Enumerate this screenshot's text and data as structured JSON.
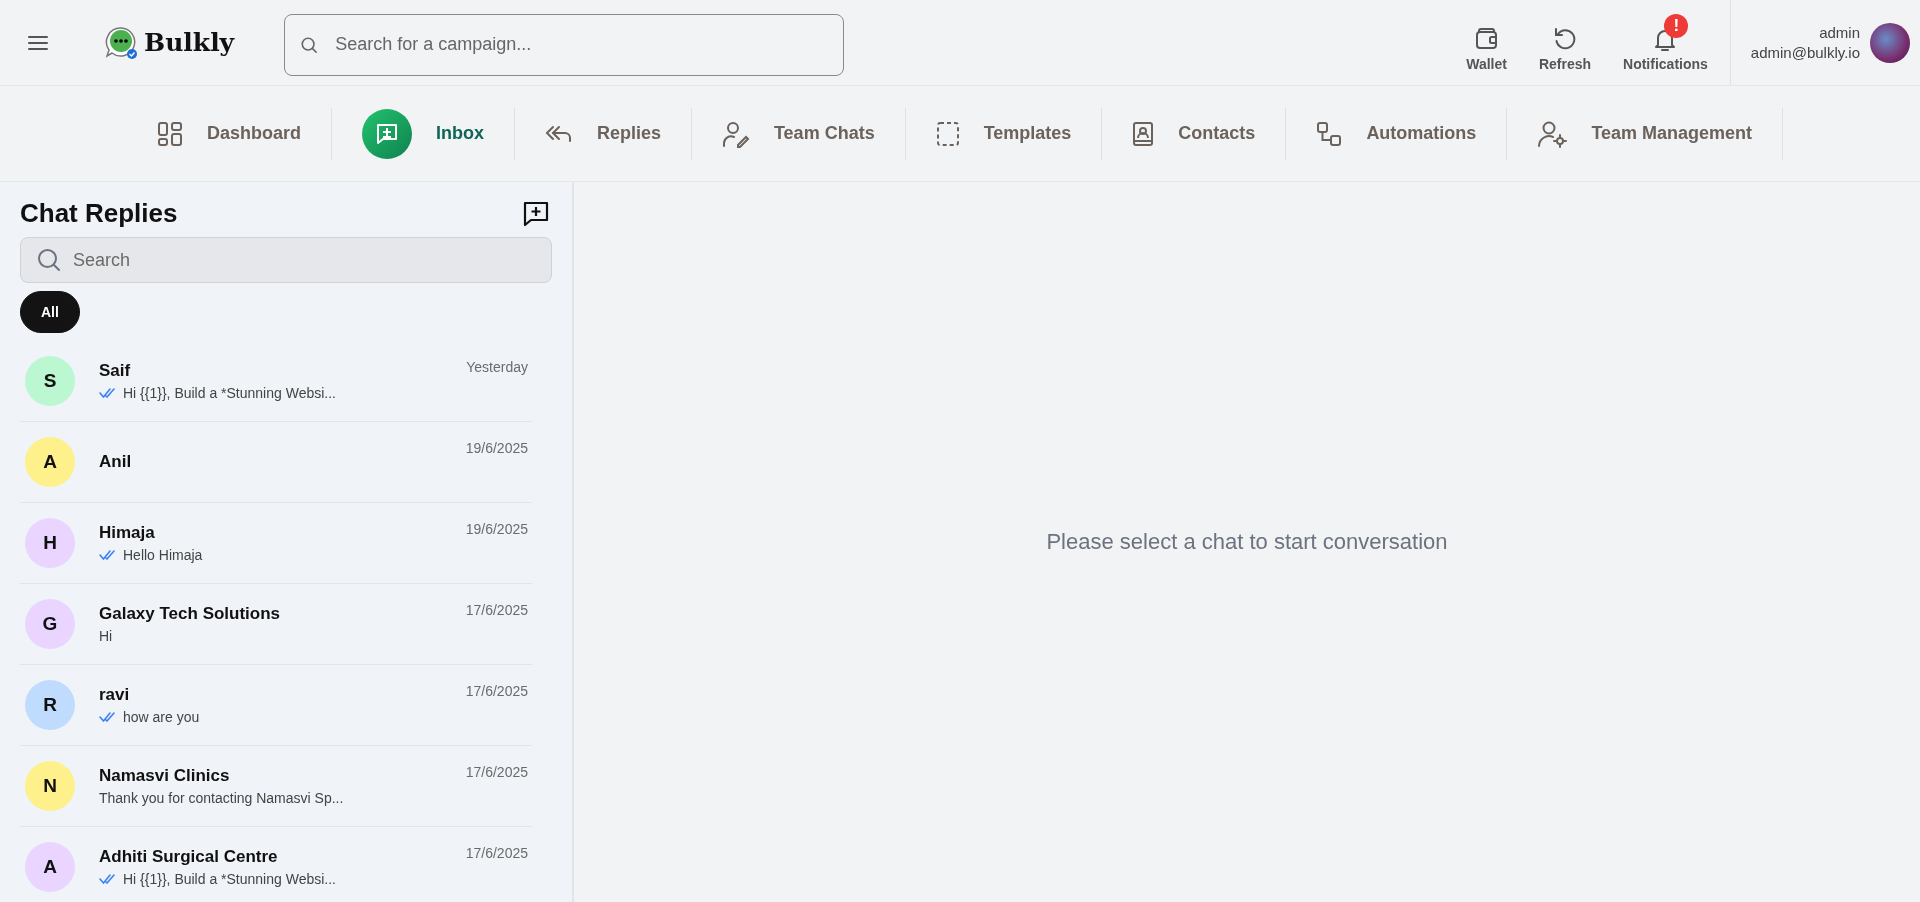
{
  "header": {
    "logo": "Bulkly",
    "search": {
      "placeholder": "Search for a campaign..."
    },
    "actions": [
      {
        "label": "Wallet"
      },
      {
        "label": "Refresh"
      },
      {
        "label": "Notifications",
        "badge": "!"
      }
    ],
    "user": {
      "name": "admin",
      "email": "admin@bulkly.io"
    }
  },
  "nav": [
    {
      "label": "Dashboard",
      "selected": false
    },
    {
      "label": "Inbox",
      "selected": true
    },
    {
      "label": "Replies",
      "selected": false
    },
    {
      "label": "Team Chats",
      "selected": false
    },
    {
      "label": "Templates",
      "selected": false
    },
    {
      "label": "Contacts",
      "selected": false
    },
    {
      "label": "Automations",
      "selected": false
    },
    {
      "label": "Team Management",
      "selected": false
    }
  ],
  "sidebar": {
    "title": "Chat Replies",
    "search": {
      "placeholder": "Search"
    },
    "filters": [
      {
        "label": "All",
        "selected": true
      }
    ],
    "chats": [
      {
        "initial": "S",
        "name": "Saif",
        "time": "Yesterday",
        "preview": "Hi {{1}}, Build a *Stunning Websi...",
        "ticked": true,
        "color": "#bbf7d0"
      },
      {
        "initial": "A",
        "name": "Anil",
        "time": "19/6/2025",
        "ticked": false,
        "color": "#fef08a"
      },
      {
        "initial": "H",
        "name": "Himaja",
        "time": "19/6/2025",
        "preview": "Hello Himaja",
        "ticked": true,
        "color": "#e9d5ff"
      },
      {
        "initial": "G",
        "name": "Galaxy Tech Solutions",
        "time": "17/6/2025",
        "preview": "Hi",
        "ticked": false,
        "color": "#e9d5ff"
      },
      {
        "initial": "R",
        "name": "ravi",
        "time": "17/6/2025",
        "preview": "how are you",
        "ticked": true,
        "color": "#bfdbfe"
      },
      {
        "initial": "N",
        "name": "Namasvi Clinics",
        "time": "17/6/2025",
        "preview": "Thank you for contacting Namasvi Sp...",
        "ticked": false,
        "color": "#fef08a"
      },
      {
        "initial": "A",
        "name": "Adhiti Surgical Centre",
        "time": "17/6/2025",
        "preview": "Hi {{1}}, Build a *Stunning Websi...",
        "ticked": true,
        "color": "#e9d5ff"
      }
    ]
  },
  "main": {
    "empty_message": "Please select a chat to start conversation"
  }
}
